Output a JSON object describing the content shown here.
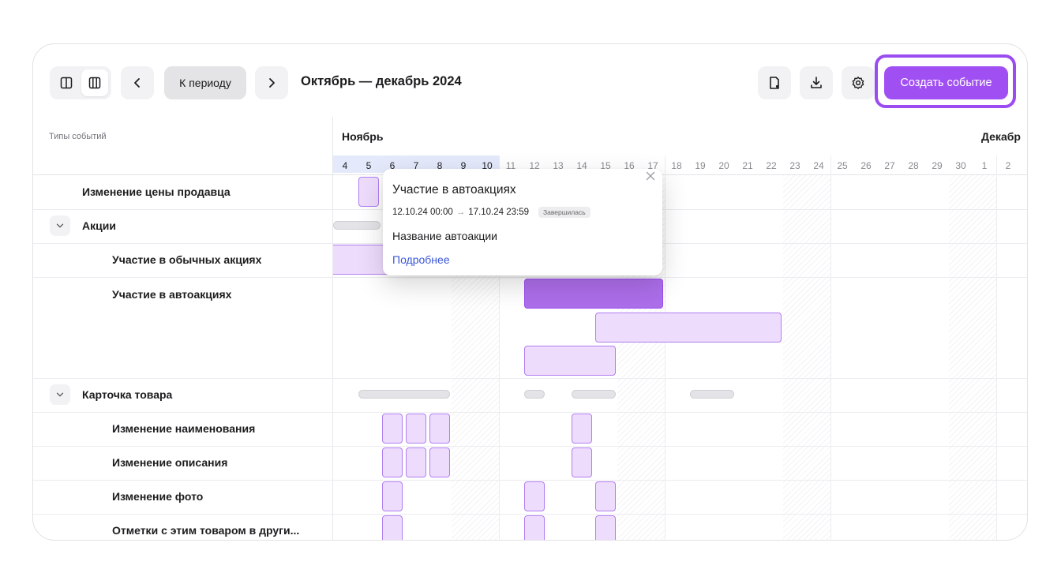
{
  "toolbar": {
    "view_icons": [
      "two-columns-icon",
      "three-columns-icon"
    ],
    "prev_icon": "chevron-left-icon",
    "period_label": "К периоду",
    "next_icon": "chevron-right-icon",
    "period_title": "Октябрь — декабрь 2024",
    "tool_icons": [
      "document-icon",
      "download-icon",
      "gear-icon"
    ],
    "create_label": "Создать событие"
  },
  "timeline": {
    "types_header": "Типы событий",
    "months": [
      "Ноябрь",
      "Декабр"
    ],
    "days": [
      "4",
      "5",
      "6",
      "7",
      "8",
      "9",
      "10",
      "11",
      "12",
      "13",
      "14",
      "15",
      "16",
      "17",
      "18",
      "19",
      "20",
      "21",
      "22",
      "23",
      "24",
      "25",
      "26",
      "27",
      "28",
      "29",
      "30",
      "1",
      "2"
    ]
  },
  "rows": [
    {
      "label": "Изменение цены продавца"
    },
    {
      "label": "Акции"
    },
    {
      "label": "Участие в обычных акциях"
    },
    {
      "label": "Участие в автоакциях"
    },
    {
      "label": "Карточка товара"
    },
    {
      "label": "Изменение наименования"
    },
    {
      "label": "Изменение описания"
    },
    {
      "label": "Изменение фото"
    },
    {
      "label": "Отметки с этим товаром в други..."
    }
  ],
  "popover": {
    "title": "Участие в автоакциях",
    "start": "12.10.24 00:00",
    "arrow": "→",
    "end": "17.10.24 23:59",
    "status": "Завершилась",
    "name": "Название автоакции",
    "link": "Подробнее"
  },
  "colors": {
    "accent": "#a04ff2",
    "event_fill": "#eedcfd",
    "event_active": "#ad6eea",
    "link": "#3a57d8"
  }
}
